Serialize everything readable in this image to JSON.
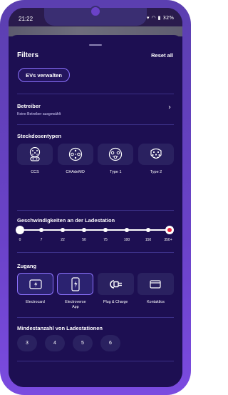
{
  "status_bar": {
    "time": "21:22",
    "battery": "32%"
  },
  "header": {
    "title": "Filters",
    "reset_label": "Reset all"
  },
  "manage_evs_label": "EVs verwalten",
  "operator": {
    "title": "Betreiber",
    "subtitle": "Keine Betreiber ausgewählt"
  },
  "plug_types": {
    "title": "Steckdosentypen",
    "items": [
      {
        "label": "CCS",
        "icon": "ccs-plug-icon"
      },
      {
        "label": "CHAdeMO",
        "icon": "chademo-plug-icon"
      },
      {
        "label": "Type 1",
        "icon": "type1-plug-icon"
      },
      {
        "label": "Type 2",
        "icon": "type2-plug-icon"
      }
    ]
  },
  "speed": {
    "title": "Geschwindigkeiten an der Ladestation",
    "stops": [
      "0",
      "7",
      "22",
      "50",
      "75",
      "100",
      "150",
      "350+"
    ],
    "selected_min": "0",
    "selected_max": "350+"
  },
  "access": {
    "title": "Zugang",
    "items": [
      {
        "label": "Electrocard",
        "icon": "charge-card-icon",
        "selected": true
      },
      {
        "label": "Electroverse App",
        "icon": "phone-app-icon",
        "selected": true
      },
      {
        "label": "Plug & Charge",
        "icon": "plug-charge-icon",
        "selected": false
      },
      {
        "label": "Kontaktlos",
        "icon": "contactless-card-icon",
        "selected": false
      }
    ]
  },
  "min_stations": {
    "title": "Mindestanzahl von Ladestationen",
    "options": [
      "3",
      "4",
      "5",
      "6"
    ]
  },
  "colors": {
    "background": "#1d0f52",
    "accent": "#8d72ff",
    "tile": "#2a2160",
    "slider_end": "#e8283f"
  }
}
